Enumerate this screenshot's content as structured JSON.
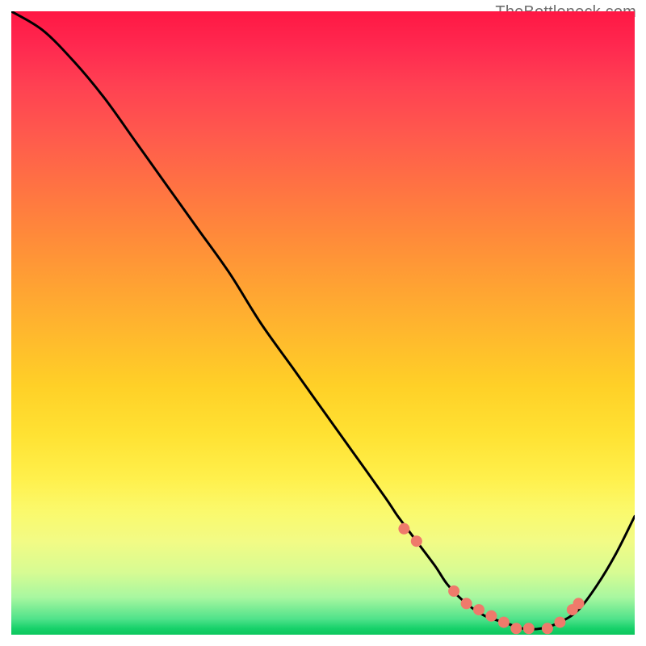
{
  "watermark": "TheBottleneck.com",
  "chart_data": {
    "type": "line",
    "title": "",
    "xlabel": "",
    "ylabel": "",
    "xlim": [
      0,
      100
    ],
    "ylim": [
      0,
      100
    ],
    "background_gradient": {
      "direction": "vertical",
      "stops": [
        {
          "pos": 0.0,
          "color": "#ff1744"
        },
        {
          "pos": 0.5,
          "color": "#ffc62a"
        },
        {
          "pos": 0.8,
          "color": "#fbf96b"
        },
        {
          "pos": 1.0,
          "color": "#0cc65d"
        }
      ]
    },
    "series": [
      {
        "name": "bottleneck-curve",
        "x": [
          0,
          5,
          10,
          15,
          20,
          25,
          30,
          35,
          40,
          45,
          50,
          55,
          60,
          62,
          65,
          68,
          70,
          73,
          76,
          79,
          82,
          85,
          88,
          91,
          94,
          97,
          100
        ],
        "y": [
          100,
          97,
          92,
          86,
          79,
          72,
          65,
          58,
          50,
          43,
          36,
          29,
          22,
          19,
          15,
          11,
          8,
          5,
          3,
          2,
          1,
          1,
          2,
          4,
          8,
          13,
          19
        ]
      }
    ],
    "markers": {
      "name": "highlight-dots",
      "color": "#ef7a6b",
      "x": [
        63,
        65,
        71,
        73,
        75,
        77,
        79,
        81,
        83,
        86,
        88,
        90,
        91
      ],
      "y": [
        17,
        15,
        7,
        5,
        4,
        3,
        2,
        1,
        1,
        1,
        2,
        4,
        5
      ]
    }
  }
}
